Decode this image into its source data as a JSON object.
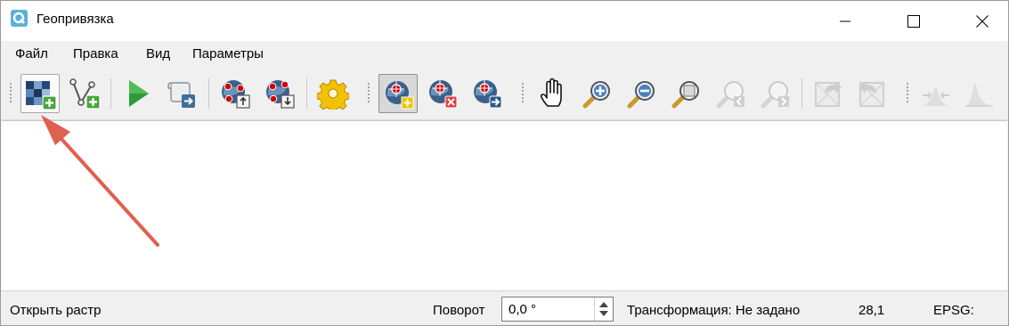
{
  "window": {
    "title": "Геопривязка",
    "controls": [
      "minimize-icon",
      "maximize-icon",
      "close-icon"
    ]
  },
  "menu": [
    "Файл",
    "Правка",
    "Вид",
    "Параметры"
  ],
  "toolbar": {
    "items": [
      {
        "id": "open-raster",
        "icon": "open-raster-icon",
        "state": "hovered"
      },
      {
        "id": "add-vector",
        "icon": "add-vector-icon"
      },
      {
        "id": "start-georef",
        "icon": "play-icon"
      },
      {
        "id": "generate-script",
        "icon": "gdal-script-icon"
      },
      {
        "id": "load-gcp",
        "icon": "load-gcp-points-icon"
      },
      {
        "id": "save-gcp",
        "icon": "save-gcp-points-icon"
      },
      {
        "id": "settings",
        "icon": "gear-icon"
      },
      {
        "id": "add-point",
        "icon": "add-point-icon",
        "state": "pressed"
      },
      {
        "id": "delete-point",
        "icon": "delete-point-icon"
      },
      {
        "id": "move-point",
        "icon": "move-point-icon"
      },
      {
        "id": "pan",
        "icon": "hand-pan-icon"
      },
      {
        "id": "zoom-in",
        "icon": "zoom-in-icon"
      },
      {
        "id": "zoom-out",
        "icon": "zoom-out-icon"
      },
      {
        "id": "zoom-layer",
        "icon": "zoom-to-layer-icon"
      },
      {
        "id": "zoom-last",
        "icon": "zoom-last-icon",
        "state": "disabled"
      },
      {
        "id": "zoom-next",
        "icon": "zoom-next-icon",
        "state": "disabled"
      },
      {
        "id": "link-georef",
        "icon": "link-georef-to-qgis-icon",
        "state": "disabled"
      },
      {
        "id": "link-qgis",
        "icon": "link-qgis-to-georef-icon",
        "state": "disabled"
      },
      {
        "id": "full-histogram",
        "icon": "full-histogram-stretch-icon",
        "state": "disabled"
      },
      {
        "id": "local-histogram",
        "icon": "local-histogram-stretch-icon",
        "state": "disabled"
      }
    ]
  },
  "status": {
    "message": "Открыть растр",
    "rotation_label": "Поворот",
    "rotation_value": "0,0 °",
    "transform": "Трансформация: Не задано",
    "coords": "28,1",
    "epsg": "EPSG:"
  },
  "colors": {
    "accent_arrow": "#e0604f",
    "play_green": "#2f9a3a",
    "gcp_red": "#d40000",
    "gcp_blue": "#3a5f8a"
  }
}
